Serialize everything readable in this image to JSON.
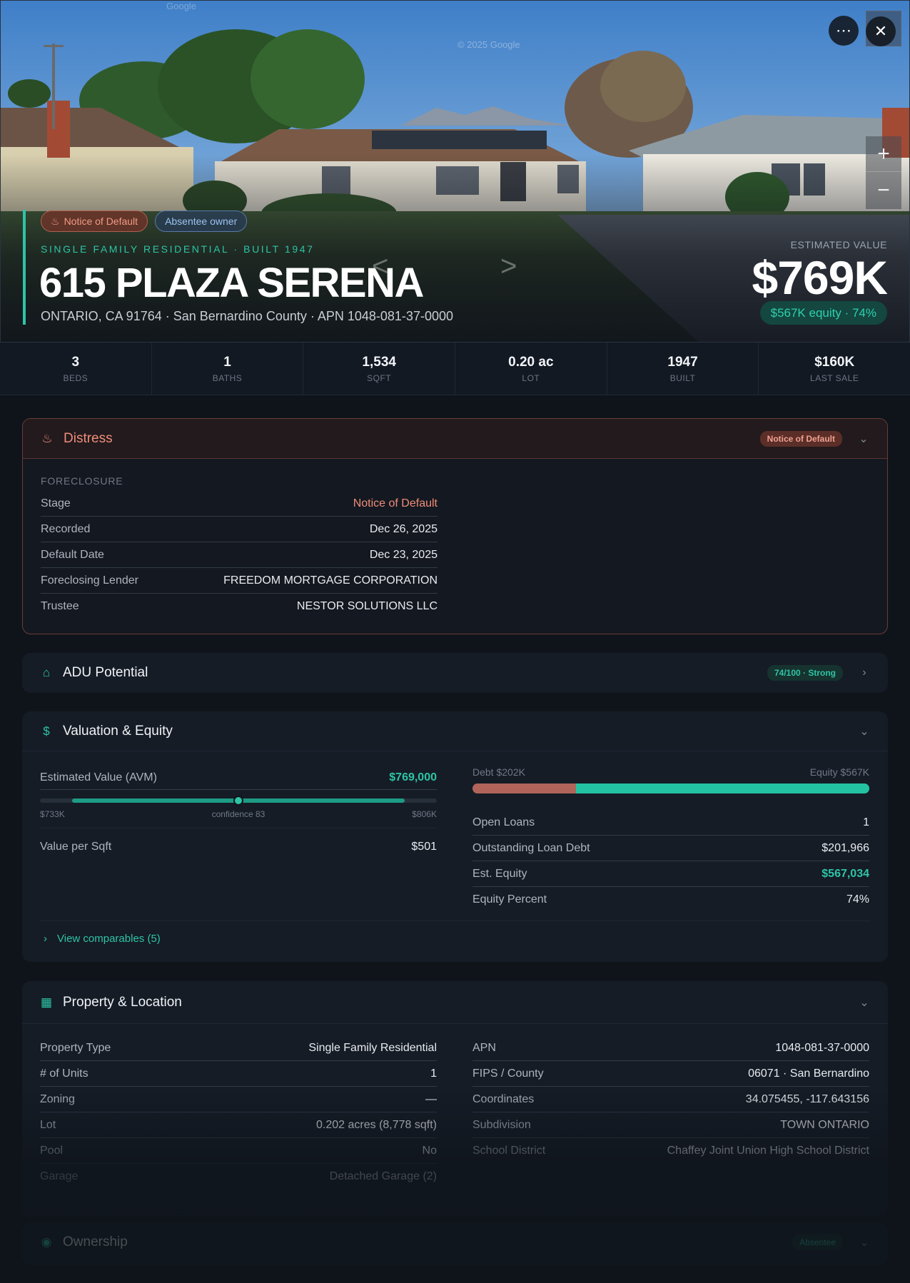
{
  "hero": {
    "watermark": "© 2025 Google",
    "watermark_top": "Google",
    "badges": [
      "Notice of Default",
      "Absentee owner"
    ],
    "subtitle": "SINGLE FAMILY RESIDENTIAL · BUILT 1947",
    "title": "615 PLAZA SERENA",
    "address": "ONTARIO, CA 91764 · San Bernardino County · APN 1048-081-37-0000",
    "estimated_label": "ESTIMATED VALUE",
    "estimated_value": "$769K",
    "equity_pill": "$567K equity · 74%",
    "icons": {
      "more": "more-icon",
      "close": "close-icon",
      "zoom_in": "plus-icon",
      "zoom_out": "minus-icon"
    }
  },
  "stats": [
    {
      "value": "3",
      "label": "BEDS"
    },
    {
      "value": "1",
      "label": "BATHS"
    },
    {
      "value": "1,534",
      "label": "SQFT"
    },
    {
      "value": "0.20 ac",
      "label": "LOT"
    },
    {
      "value": "1947",
      "label": "BUILT"
    },
    {
      "value": "$160K",
      "label": "LAST SALE"
    }
  ],
  "distress": {
    "title": "Distress",
    "tag": "Notice of Default",
    "section": "FORECLOSURE",
    "rows": [
      {
        "k": "Stage",
        "v": "Notice of Default"
      },
      {
        "k": "Recorded",
        "v": "Dec 26, 2025"
      },
      {
        "k": "Default Date",
        "v": "Dec 23, 2025"
      },
      {
        "k": "Foreclosing Lender",
        "v": "FREEDOM MORTGAGE CORPORATION"
      },
      {
        "k": "Trustee",
        "v": "NESTOR SOLUTIONS LLC"
      }
    ]
  },
  "adu": {
    "title": "ADU Potential",
    "score": "74/100 · Strong"
  },
  "valuation": {
    "title": "Valuation & Equity",
    "avm_label": "Estimated Value (AVM)",
    "avm_value": "$769,000",
    "range_low": "$733K",
    "range_high": "$806K",
    "confidence": "confidence 83",
    "value_per_sqft_label": "Value per Sqft",
    "value_per_sqft": "$501",
    "debt_label": "Debt $202K",
    "equity_label": "Equity $567K",
    "debt_fraction": 0.26,
    "rows": [
      {
        "k": "Open Loans",
        "v": "1"
      },
      {
        "k": "Outstanding Loan Debt",
        "v": "$201,966"
      },
      {
        "k": "Est. Equity",
        "v": "$567,034"
      },
      {
        "k": "Equity Percent",
        "v": "74%"
      }
    ],
    "comparables_link": "View comparables (5)"
  },
  "property": {
    "title": "Property & Location",
    "left": [
      {
        "k": "Property Type",
        "v": "Single Family Residential"
      },
      {
        "k": "# of Units",
        "v": "1"
      },
      {
        "k": "Zoning",
        "v": "—"
      },
      {
        "k": "Lot",
        "v": "0.202 acres (8,778 sqft)"
      },
      {
        "k": "Pool",
        "v": "No"
      },
      {
        "k": "Garage",
        "v": "Detached Garage (2)"
      }
    ],
    "right": [
      {
        "k": "APN",
        "v": "1048-081-37-0000"
      },
      {
        "k": "FIPS / County",
        "v": "06071 · San Bernardino"
      },
      {
        "k": "Coordinates",
        "v": "34.075455, -117.643156"
      },
      {
        "k": "Subdivision",
        "v": "TOWN ONTARIO"
      },
      {
        "k": "School District",
        "v": "Chaffey Joint Union High School District"
      }
    ]
  },
  "ownership": {
    "title": "Ownership",
    "tag": "Absentee"
  },
  "colors": {
    "accent": "#2ec4a6",
    "distress": "#ef8d79",
    "debt": "#b0645a",
    "absentee": "#9dc1f0"
  }
}
